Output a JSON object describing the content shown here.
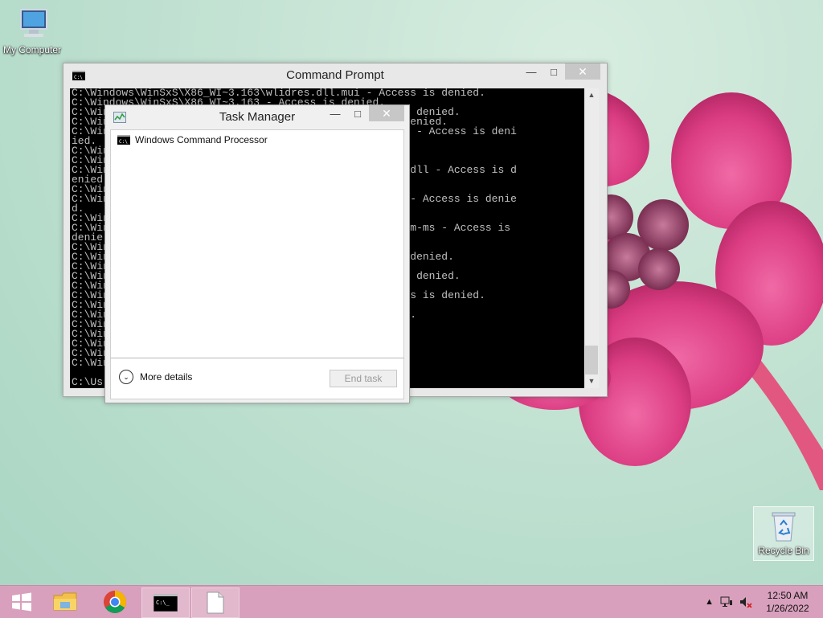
{
  "desktop": {
    "icons": [
      {
        "label": "My Computer"
      },
      {
        "label": "Recycle Bin"
      }
    ]
  },
  "cmd_window": {
    "title": "Command Prompt",
    "lines": [
      "C:\\Windows\\WinSxS\\X86_WI~3.163\\wlidres.dll.mui - Access is denied.",
      "C:\\Windows\\WinSxS\\X86_WI~3.163 - Access is denied.",
      "C:\\Win                                     - Access is denied.",
      "C:\\Win                                      ccess is denied.",
      "C:\\Win                                     nthesis.dll - Access is deni",
      "ied.",
      "C:\\Win                                      enied.",
      "C:\\Win",
      "C:\\Win                                     cationData.dll - Access is d",
      "enied",
      "C:\\Win",
      "C:\\Win                                     ession.dll - Access is denie",
      "d.",
      "C:\\Win",
      "C:\\Win                                     --ppdlic.xrm-ms - Access is",
      "denie",
      "C:\\Win",
      "C:\\Win                                      Access is denied.",
      "C:\\Win",
      "C:\\Win                                     - Access is denied.",
      "C:\\Win",
      "C:\\Win                                     dll - Access is denied.",
      "C:\\Win",
      "C:\\Win                                     s is denied.",
      "C:\\Win",
      "C:\\Win",
      "C:\\Win",
      "C:\\Win",
      "C:\\Win",
      "",
      "C:\\Us"
    ]
  },
  "task_manager": {
    "title": "Task Manager",
    "process": "Windows Command Processor",
    "more_details": "More details",
    "end_task": "End task"
  },
  "taskbar": {
    "time": "12:50 AM",
    "date": "1/26/2022"
  },
  "colors": {
    "taskbar": "#d8a0bc",
    "flower": "#e0508f"
  }
}
